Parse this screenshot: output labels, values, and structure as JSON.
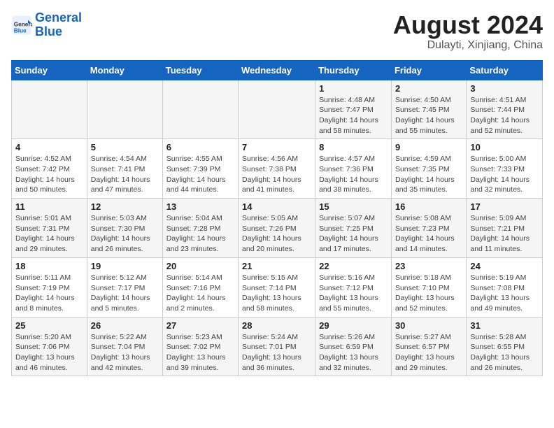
{
  "header": {
    "logo_line1": "General",
    "logo_line2": "Blue",
    "month_year": "August 2024",
    "location": "Dulayti, Xinjiang, China"
  },
  "days_of_week": [
    "Sunday",
    "Monday",
    "Tuesday",
    "Wednesday",
    "Thursday",
    "Friday",
    "Saturday"
  ],
  "weeks": [
    [
      {
        "day": "",
        "info": ""
      },
      {
        "day": "",
        "info": ""
      },
      {
        "day": "",
        "info": ""
      },
      {
        "day": "",
        "info": ""
      },
      {
        "day": "1",
        "info": "Sunrise: 4:48 AM\nSunset: 7:47 PM\nDaylight: 14 hours\nand 58 minutes."
      },
      {
        "day": "2",
        "info": "Sunrise: 4:50 AM\nSunset: 7:45 PM\nDaylight: 14 hours\nand 55 minutes."
      },
      {
        "day": "3",
        "info": "Sunrise: 4:51 AM\nSunset: 7:44 PM\nDaylight: 14 hours\nand 52 minutes."
      }
    ],
    [
      {
        "day": "4",
        "info": "Sunrise: 4:52 AM\nSunset: 7:42 PM\nDaylight: 14 hours\nand 50 minutes."
      },
      {
        "day": "5",
        "info": "Sunrise: 4:54 AM\nSunset: 7:41 PM\nDaylight: 14 hours\nand 47 minutes."
      },
      {
        "day": "6",
        "info": "Sunrise: 4:55 AM\nSunset: 7:39 PM\nDaylight: 14 hours\nand 44 minutes."
      },
      {
        "day": "7",
        "info": "Sunrise: 4:56 AM\nSunset: 7:38 PM\nDaylight: 14 hours\nand 41 minutes."
      },
      {
        "day": "8",
        "info": "Sunrise: 4:57 AM\nSunset: 7:36 PM\nDaylight: 14 hours\nand 38 minutes."
      },
      {
        "day": "9",
        "info": "Sunrise: 4:59 AM\nSunset: 7:35 PM\nDaylight: 14 hours\nand 35 minutes."
      },
      {
        "day": "10",
        "info": "Sunrise: 5:00 AM\nSunset: 7:33 PM\nDaylight: 14 hours\nand 32 minutes."
      }
    ],
    [
      {
        "day": "11",
        "info": "Sunrise: 5:01 AM\nSunset: 7:31 PM\nDaylight: 14 hours\nand 29 minutes."
      },
      {
        "day": "12",
        "info": "Sunrise: 5:03 AM\nSunset: 7:30 PM\nDaylight: 14 hours\nand 26 minutes."
      },
      {
        "day": "13",
        "info": "Sunrise: 5:04 AM\nSunset: 7:28 PM\nDaylight: 14 hours\nand 23 minutes."
      },
      {
        "day": "14",
        "info": "Sunrise: 5:05 AM\nSunset: 7:26 PM\nDaylight: 14 hours\nand 20 minutes."
      },
      {
        "day": "15",
        "info": "Sunrise: 5:07 AM\nSunset: 7:25 PM\nDaylight: 14 hours\nand 17 minutes."
      },
      {
        "day": "16",
        "info": "Sunrise: 5:08 AM\nSunset: 7:23 PM\nDaylight: 14 hours\nand 14 minutes."
      },
      {
        "day": "17",
        "info": "Sunrise: 5:09 AM\nSunset: 7:21 PM\nDaylight: 14 hours\nand 11 minutes."
      }
    ],
    [
      {
        "day": "18",
        "info": "Sunrise: 5:11 AM\nSunset: 7:19 PM\nDaylight: 14 hours\nand 8 minutes."
      },
      {
        "day": "19",
        "info": "Sunrise: 5:12 AM\nSunset: 7:17 PM\nDaylight: 14 hours\nand 5 minutes."
      },
      {
        "day": "20",
        "info": "Sunrise: 5:14 AM\nSunset: 7:16 PM\nDaylight: 14 hours\nand 2 minutes."
      },
      {
        "day": "21",
        "info": "Sunrise: 5:15 AM\nSunset: 7:14 PM\nDaylight: 13 hours\nand 58 minutes."
      },
      {
        "day": "22",
        "info": "Sunrise: 5:16 AM\nSunset: 7:12 PM\nDaylight: 13 hours\nand 55 minutes."
      },
      {
        "day": "23",
        "info": "Sunrise: 5:18 AM\nSunset: 7:10 PM\nDaylight: 13 hours\nand 52 minutes."
      },
      {
        "day": "24",
        "info": "Sunrise: 5:19 AM\nSunset: 7:08 PM\nDaylight: 13 hours\nand 49 minutes."
      }
    ],
    [
      {
        "day": "25",
        "info": "Sunrise: 5:20 AM\nSunset: 7:06 PM\nDaylight: 13 hours\nand 46 minutes."
      },
      {
        "day": "26",
        "info": "Sunrise: 5:22 AM\nSunset: 7:04 PM\nDaylight: 13 hours\nand 42 minutes."
      },
      {
        "day": "27",
        "info": "Sunrise: 5:23 AM\nSunset: 7:02 PM\nDaylight: 13 hours\nand 39 minutes."
      },
      {
        "day": "28",
        "info": "Sunrise: 5:24 AM\nSunset: 7:01 PM\nDaylight: 13 hours\nand 36 minutes."
      },
      {
        "day": "29",
        "info": "Sunrise: 5:26 AM\nSunset: 6:59 PM\nDaylight: 13 hours\nand 32 minutes."
      },
      {
        "day": "30",
        "info": "Sunrise: 5:27 AM\nSunset: 6:57 PM\nDaylight: 13 hours\nand 29 minutes."
      },
      {
        "day": "31",
        "info": "Sunrise: 5:28 AM\nSunset: 6:55 PM\nDaylight: 13 hours\nand 26 minutes."
      }
    ]
  ]
}
